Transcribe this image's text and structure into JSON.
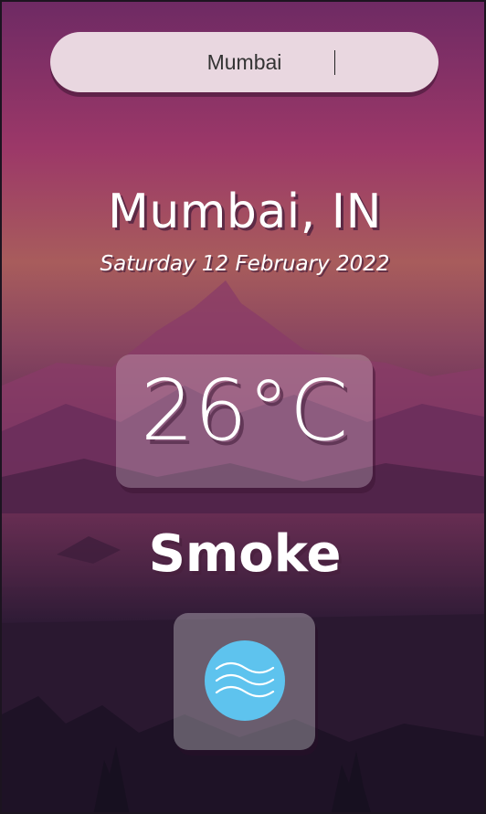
{
  "search": {
    "value": "Mumbai",
    "placeholder": ""
  },
  "location": {
    "label": "Mumbai, IN"
  },
  "date": {
    "label": "Saturday 12 February 2022"
  },
  "weather": {
    "temperature": "26°C",
    "condition": "Smoke",
    "icon": "smoke-icon",
    "icon_color": "#5ec3ee"
  }
}
